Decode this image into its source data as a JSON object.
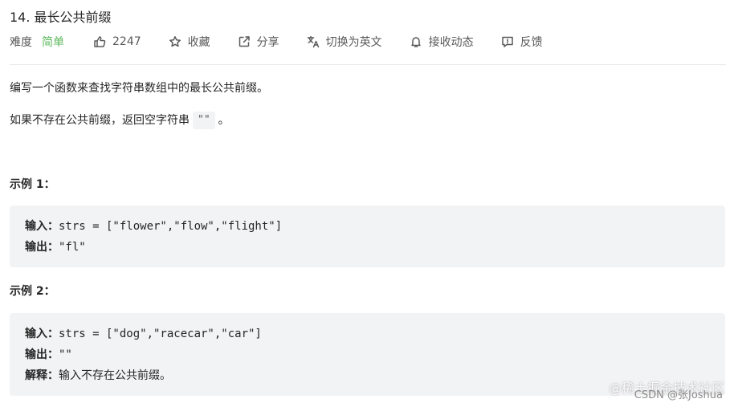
{
  "problem": {
    "title": "14. 最长公共前缀"
  },
  "meta": {
    "difficulty_label": "难度",
    "difficulty_value": "简单",
    "likes": "2247",
    "favorite_label": "收藏",
    "share_label": "分享",
    "translate_label": "切换为英文",
    "notify_label": "接收动态",
    "feedback_label": "反馈"
  },
  "colors": {
    "difficulty_easy": "#5cb85c",
    "code_bg": "#f2f3f5",
    "divider": "#e8e8e8"
  },
  "description": {
    "line1": "编写一个函数来查找字符串数组中的最长公共前缀。",
    "line2_prefix": "如果不存在公共前缀，返回空字符串",
    "line2_code": "\"\"",
    "line2_suffix": "。"
  },
  "examples": [
    {
      "heading": "示例 1：",
      "input_label": "输入：",
      "input_value": "strs = [\"flower\",\"flow\",\"flight\"]",
      "output_label": "输出：",
      "output_value": "\"fl\""
    },
    {
      "heading": "示例 2：",
      "input_label": "输入：",
      "input_value": "strs = [\"dog\",\"racecar\",\"car\"]",
      "output_label": "输出：",
      "output_value": "\"\"",
      "explain_label": "解释：",
      "explain_value": "输入不存在公共前缀。"
    }
  ],
  "watermark": {
    "line1": "@稀土掘金技术社区",
    "line2": "CSDN @张Joshua"
  }
}
